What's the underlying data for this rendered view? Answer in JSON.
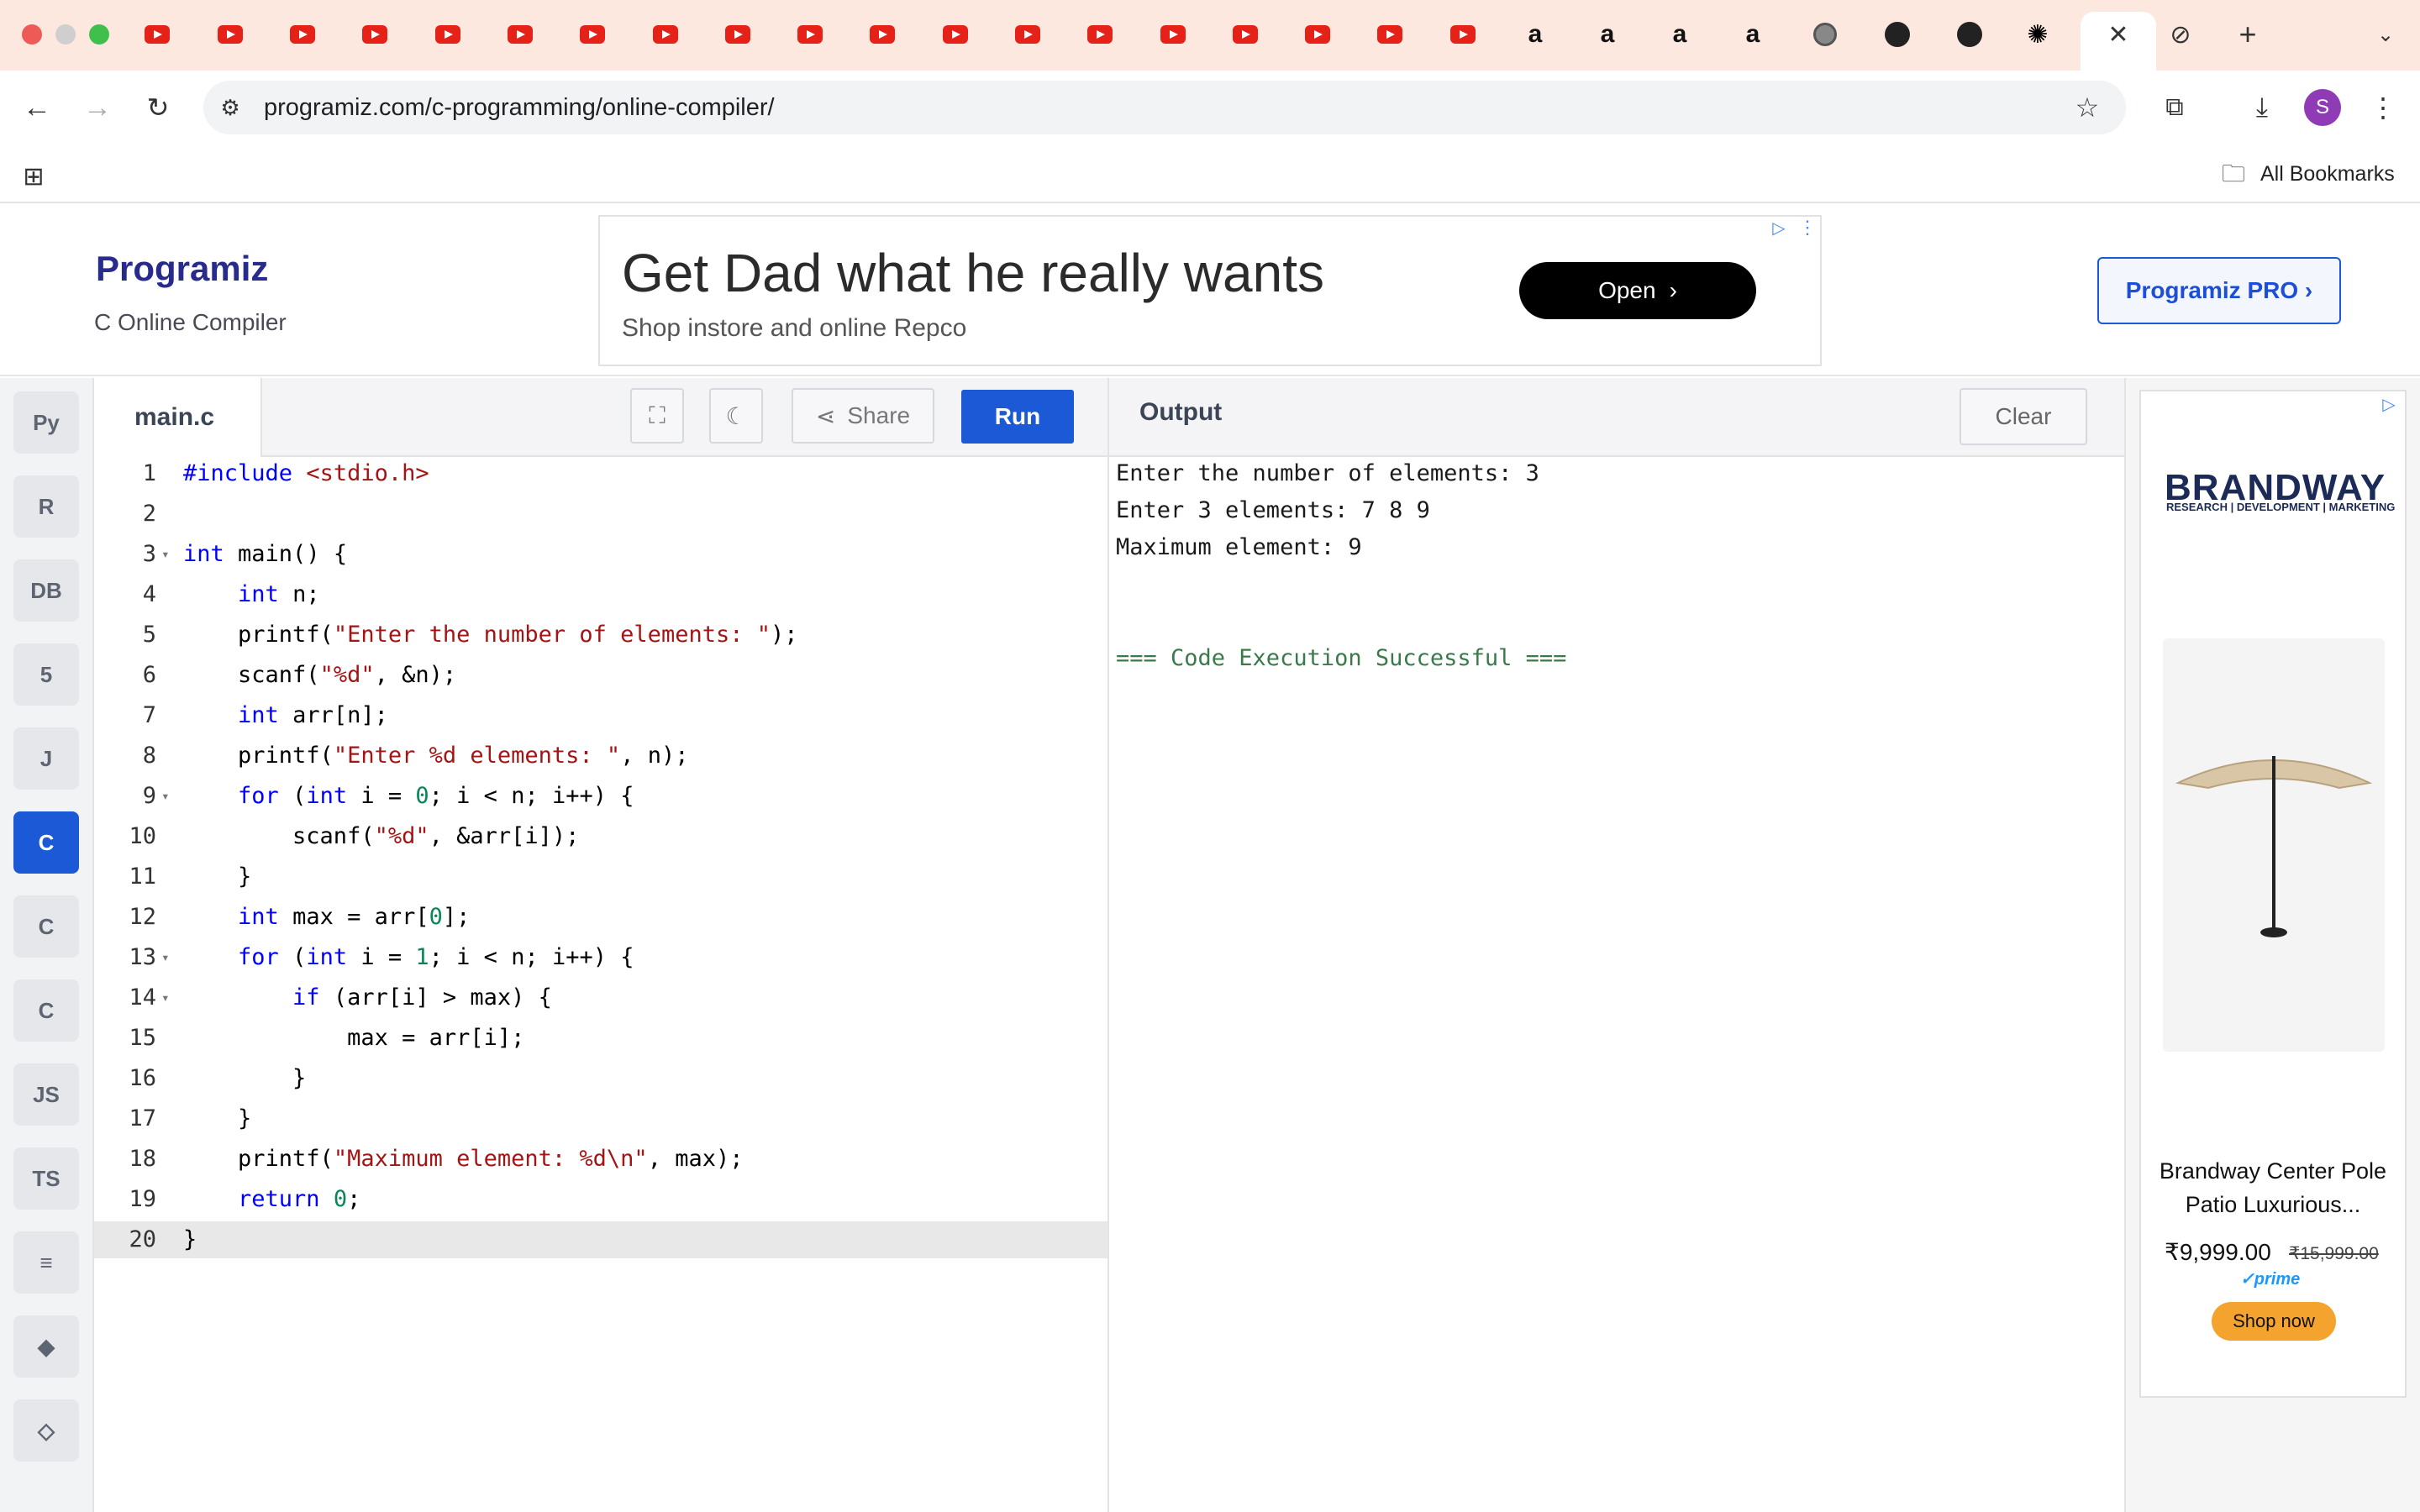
{
  "browser": {
    "url": "programiz.com/c-programming/online-compiler/",
    "bookmarks_label": "All Bookmarks",
    "profile_initial": "S"
  },
  "header": {
    "logo": "Programiz",
    "subtitle": "C Online Compiler",
    "pro_button": "Programiz PRO ›"
  },
  "ad_banner": {
    "title": "Get Dad what he really wants",
    "subtitle": "Shop instore and online Repco",
    "open_label": "Open"
  },
  "sidebar": {
    "items": [
      {
        "name": "python",
        "label": "Py",
        "active": false
      },
      {
        "name": "r",
        "label": "R",
        "active": false
      },
      {
        "name": "sql",
        "label": "DB",
        "active": false
      },
      {
        "name": "html",
        "label": "5",
        "active": false
      },
      {
        "name": "java",
        "label": "J",
        "active": false
      },
      {
        "name": "c",
        "label": "C",
        "active": true
      },
      {
        "name": "cpp",
        "label": "C",
        "active": false
      },
      {
        "name": "csharp",
        "label": "C",
        "active": false
      },
      {
        "name": "js",
        "label": "JS",
        "active": false
      },
      {
        "name": "ts",
        "label": "TS",
        "active": false
      },
      {
        "name": "go",
        "label": "≡",
        "active": false
      },
      {
        "name": "swift",
        "label": "◆",
        "active": false
      },
      {
        "name": "kotlin",
        "label": "◇",
        "active": false
      }
    ]
  },
  "editor": {
    "filename": "main.c",
    "share_label": "Share",
    "run_label": "Run",
    "lines": [
      "#include <stdio.h>",
      "",
      "int main() {",
      "    int n;",
      "    printf(\"Enter the number of elements: \");",
      "    scanf(\"%d\", &n);",
      "    int arr[n];",
      "    printf(\"Enter %d elements: \", n);",
      "    for (int i = 0; i < n; i++) {",
      "        scanf(\"%d\", &arr[i]);",
      "    }",
      "    int max = arr[0];",
      "    for (int i = 1; i < n; i++) {",
      "        if (arr[i] > max) {",
      "            max = arr[i];",
      "        }",
      "    }",
      "    printf(\"Maximum element: %d\\n\", max);",
      "    return 0;",
      "}"
    ]
  },
  "output": {
    "title": "Output",
    "clear_label": "Clear",
    "lines": [
      "Enter the number of elements: 3",
      "Enter 3 elements: 7 8 9",
      "Maximum element: 9"
    ],
    "status": "=== Code Execution Successful ==="
  },
  "side_ad": {
    "brand": "BRANDWAY",
    "brand_tagline": "RESEARCH | DEVELOPMENT | MARKETING",
    "product_name": "Brandway Center Pole Patio Luxurious...",
    "price": "₹9,999.00",
    "old_price": "₹15,999.00",
    "prime": "✓prime",
    "shop_label": "Shop now"
  }
}
